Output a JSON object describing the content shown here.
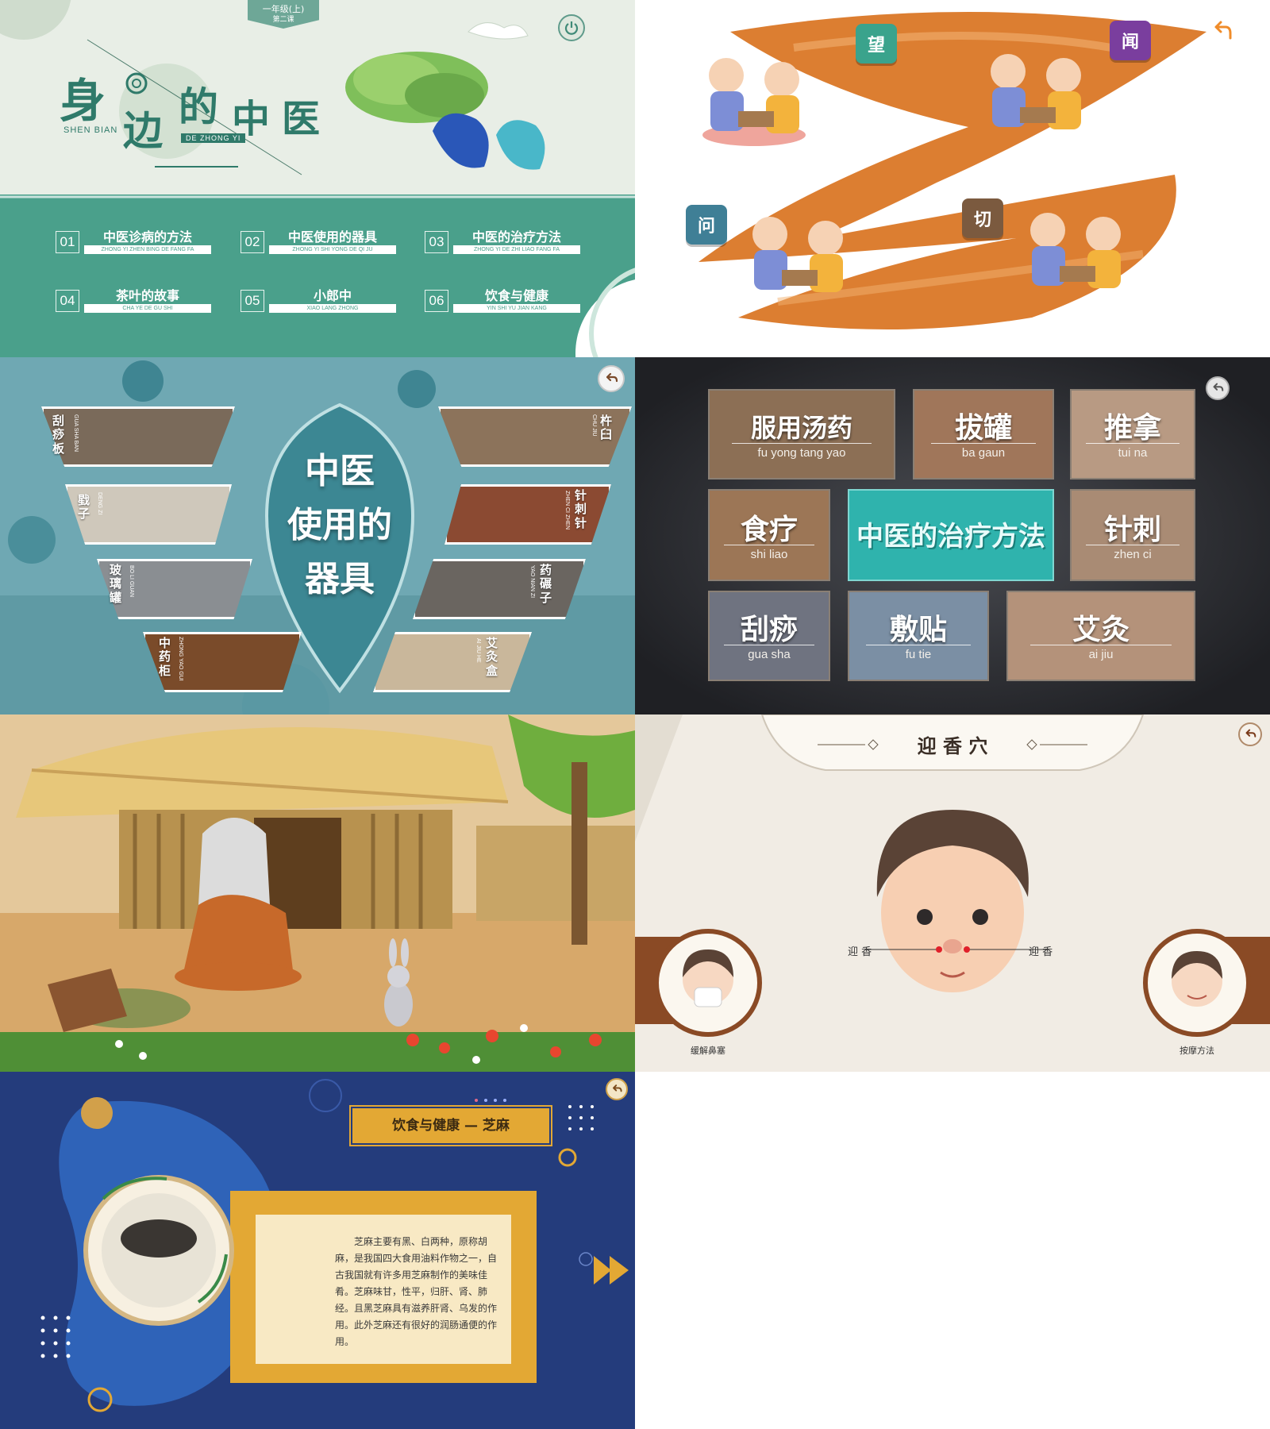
{
  "colors": {
    "teal": "#4aa08b",
    "mint_bg": "#e8eee6",
    "orange_brush": "#d9731f",
    "tools_bg": "#6fa8b3",
    "dark_bg": "#2b2d31",
    "accent_teal": "#2fb3ad",
    "navy": "#243c7c",
    "gold": "#e3a834",
    "brown": "#8a4a25"
  },
  "icons": {
    "power": "power-icon",
    "back": "back-arrow-icon",
    "play": "play-arrow-icon"
  },
  "cover": {
    "grade": "一年级(上)",
    "lesson": "第二课",
    "title_chars": [
      "身",
      "边",
      "的",
      "中",
      "医"
    ],
    "pinyin_left": "SHEN BIAN",
    "pinyin_right": "DE ZHONG YI",
    "menu": [
      {
        "num": "01",
        "label": "中医诊病的方法",
        "pinyin": "ZHONG YI ZHEN BING DE FANG FA"
      },
      {
        "num": "02",
        "label": "中医使用的器具",
        "pinyin": "ZHONG YI SHI YONG DE QI JU"
      },
      {
        "num": "03",
        "label": "中医的治疗方法",
        "pinyin": "ZHONG YI DE ZHI LIAO FANG FA"
      },
      {
        "num": "04",
        "label": "茶叶的故事",
        "pinyin": "CHA YE DE GU SHI"
      },
      {
        "num": "05",
        "label": "小郎中",
        "pinyin": "XIAO LANG ZHONG"
      },
      {
        "num": "06",
        "label": "饮食与健康",
        "pinyin": "YIN SHI YU JIAN KANG"
      }
    ]
  },
  "diagnosis": {
    "buttons": [
      {
        "label": "望",
        "color": "#3aa38c"
      },
      {
        "label": "闻",
        "color": "#7a3e9e"
      },
      {
        "label": "问",
        "color": "#3f7f96"
      },
      {
        "label": "切",
        "color": "#7b5a3f"
      }
    ]
  },
  "tools": {
    "center_lines": [
      "中医",
      "使用的",
      "器具"
    ],
    "left": [
      {
        "label": "刮痧板",
        "pinyin": "GUA SHA BAN"
      },
      {
        "label": "戥子",
        "pinyin": "DENG ZI"
      },
      {
        "label": "玻璃罐",
        "pinyin": "BO LI GUAN"
      },
      {
        "label": "中药柜",
        "pinyin": "ZHONG YAO GUI"
      }
    ],
    "right": [
      {
        "label": "杵臼",
        "pinyin": "CHU JIU"
      },
      {
        "label": "针刺针",
        "pinyin": "ZHEN CI ZHEN"
      },
      {
        "label": "药碾子",
        "pinyin": "YAO NIAN ZI"
      },
      {
        "label": "艾灸盒",
        "pinyin": "AI JIU HE"
      }
    ]
  },
  "treatments": {
    "center": "中医的治疗方法",
    "tiles": [
      {
        "cn": "服用汤药",
        "py": "fu yong tang yao",
        "bg": "#8c6f55"
      },
      {
        "cn": "拔罐",
        "py": "ba gaun",
        "bg": "#a0765a"
      },
      {
        "cn": "推拿",
        "py": "tui na",
        "bg": "#b89a83"
      },
      {
        "cn": "食疗",
        "py": "shi liao",
        "bg": "#9c7656"
      },
      {
        "cn": "针刺",
        "py": "zhen ci",
        "bg": "#a98b74"
      },
      {
        "cn": "刮痧",
        "py": "gua sha",
        "bg": "#6f7380"
      },
      {
        "cn": "敷贴",
        "py": "fu tie",
        "bg": "#7b8fa4"
      },
      {
        "cn": "艾灸",
        "py": "ai jiu",
        "bg": "#b4927a"
      }
    ]
  },
  "acupoint": {
    "title": "迎 香 穴",
    "left_point": "迎 香",
    "right_point": "迎 香",
    "left_caption": "缓解鼻塞",
    "right_caption": "按摩方法"
  },
  "food": {
    "title": "饮食与健康 — 芝麻",
    "body": "芝麻主要有黑、白两种，原称胡麻，是我国四大食用油料作物之一，自古我国就有许多用芝麻制作的美味佳肴。芝麻味甘，性平，归肝、肾、肺经。且黑芝麻具有滋养肝肾、乌发的作用。此外芝麻还有很好的润肠通便的作用。"
  }
}
